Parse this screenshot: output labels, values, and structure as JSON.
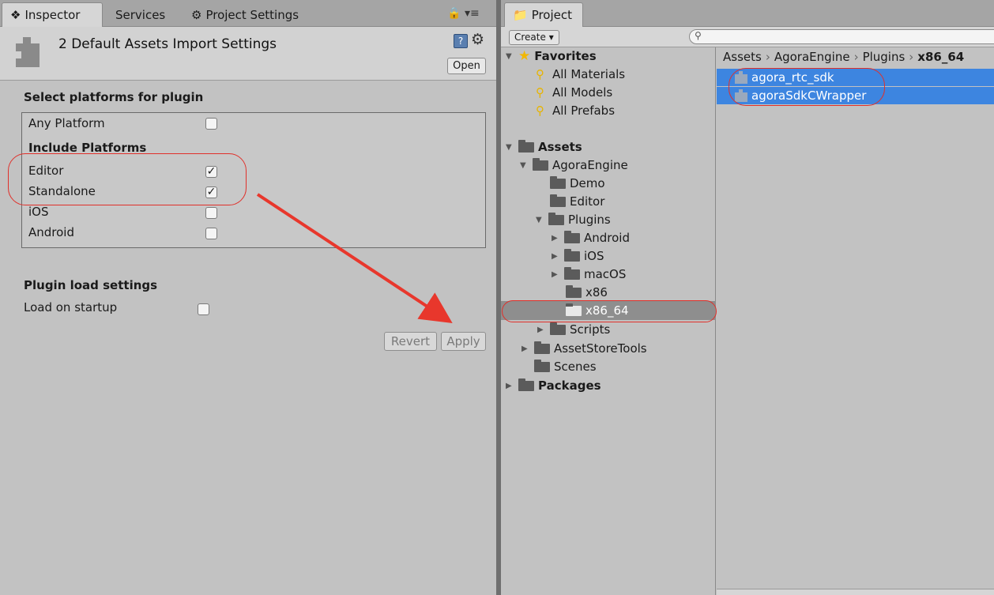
{
  "inspector_tabs": {
    "inspector": "Inspector",
    "services": "Services",
    "project_settings": "Project Settings"
  },
  "inspector": {
    "title": "2 Default Assets Import Settings",
    "open_label": "Open",
    "select_platforms_heading": "Select platforms for plugin",
    "any_platform": "Any Platform",
    "include_platforms_heading": "Include Platforms",
    "platforms": [
      {
        "label": "Editor",
        "checked": true
      },
      {
        "label": "Standalone",
        "checked": true
      },
      {
        "label": "iOS",
        "checked": false
      },
      {
        "label": "Android",
        "checked": false
      }
    ],
    "plugin_load_heading": "Plugin load settings",
    "load_on_startup": "Load on startup",
    "revert_label": "Revert",
    "apply_label": "Apply"
  },
  "project": {
    "tab_label": "Project",
    "create_label": "Create ▾",
    "favorites_label": "Favorites",
    "favorites": [
      "All Materials",
      "All Models",
      "All Prefabs"
    ],
    "assets_label": "Assets",
    "tree": {
      "agora_engine": "AgoraEngine",
      "demo": "Demo",
      "editor": "Editor",
      "plugins": "Plugins",
      "android": "Android",
      "ios": "iOS",
      "macos": "macOS",
      "x86": "x86",
      "x86_64": "x86_64",
      "scripts": "Scripts",
      "asset_store_tools": "AssetStoreTools",
      "scenes": "Scenes",
      "packages": "Packages"
    },
    "breadcrumb": [
      "Assets",
      "AgoraEngine",
      "Plugins",
      "x86_64"
    ],
    "files": [
      "agora_rtc_sdk",
      "agoraSdkCWrapper"
    ]
  },
  "colors": {
    "selection_blue": "#3d85e0",
    "annotation_red": "#e0302a"
  }
}
